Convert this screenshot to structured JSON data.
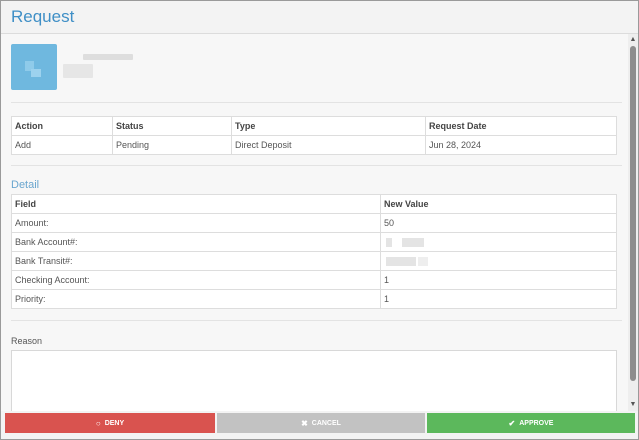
{
  "header": {
    "title": "Request"
  },
  "request_table": {
    "headers": [
      "Action",
      "Status",
      "Type",
      "Request Date"
    ],
    "row": [
      "Add",
      "Pending",
      "Direct Deposit",
      "Jun 28, 2024"
    ]
  },
  "detail": {
    "title": "Detail",
    "headers": [
      "Field",
      "New Value"
    ],
    "rows": [
      {
        "field": "Amount:",
        "value": "50"
      },
      {
        "field": "Bank Account#:",
        "value": ""
      },
      {
        "field": "Bank Transit#:",
        "value": ""
      },
      {
        "field": "Checking Account:",
        "value": "1"
      },
      {
        "field": "Priority:",
        "value": "1"
      }
    ]
  },
  "reason": {
    "label": "Reason",
    "value": ""
  },
  "buttons": {
    "deny": "DENY",
    "cancel": "CANCEL",
    "approve": "APPROVE"
  },
  "icons": {
    "deny": "circle-outline-icon",
    "cancel": "x-icon",
    "approve": "check-circle-icon",
    "avatar": "user-avatar"
  },
  "colors": {
    "title": "#3f8fc6",
    "deny": "#d9534f",
    "cancel": "#c2c2c2",
    "approve": "#5cb85c",
    "avatar": "#6fb8df"
  }
}
